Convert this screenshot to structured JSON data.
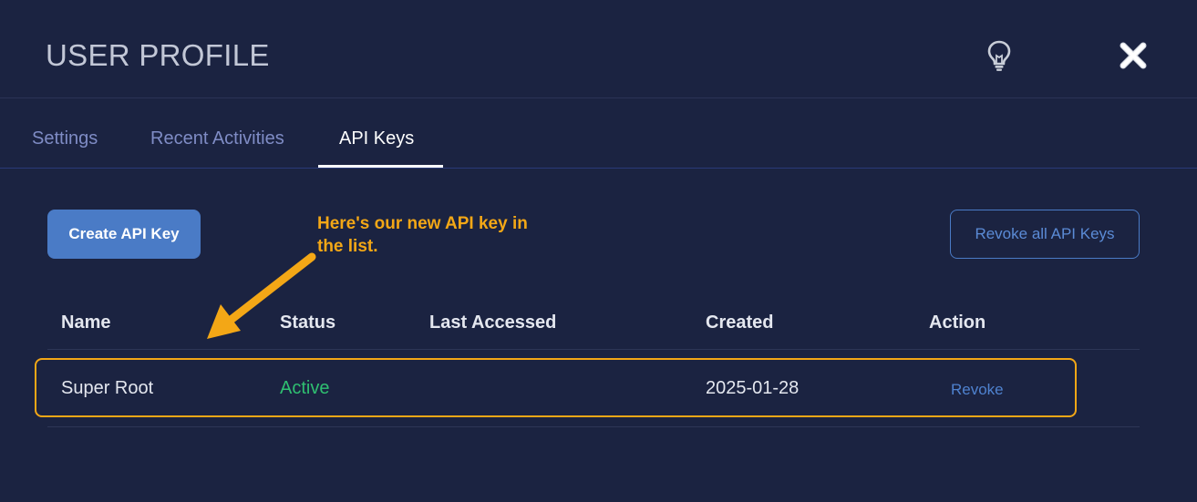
{
  "header": {
    "title": "USER PROFILE",
    "hint_icon": "lightbulb-icon",
    "close_icon": "close-icon"
  },
  "tabs": [
    {
      "label": "Settings",
      "active": false
    },
    {
      "label": "Recent Activities",
      "active": false
    },
    {
      "label": "API Keys",
      "active": true
    }
  ],
  "toolbar": {
    "create_label": "Create API Key",
    "revoke_all_label": "Revoke all API Keys"
  },
  "annotation": {
    "text": "Here's our new API key in the list."
  },
  "table": {
    "columns": [
      "Name",
      "Status",
      "Last Accessed",
      "Created",
      "Action"
    ],
    "rows": [
      {
        "name": "Super Root",
        "status": "Active",
        "last_accessed": "",
        "created": "2025-01-28",
        "action": "Revoke"
      }
    ]
  },
  "colors": {
    "background": "#1b2341",
    "accent": "#4a7bc6",
    "annotation": "#f3a716",
    "status_active": "#2fbf71"
  }
}
